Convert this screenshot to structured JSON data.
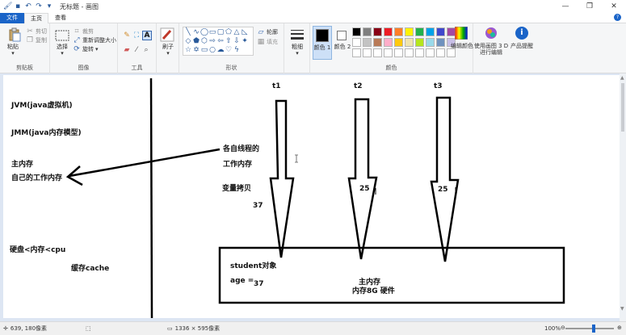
{
  "window": {
    "title": "无标题 - 画图",
    "controls": [
      "—",
      "❐",
      "✕"
    ]
  },
  "menu": {
    "file": "文件",
    "tabs": [
      "主页",
      "查看"
    ]
  },
  "ribbon": {
    "clipboard": {
      "paste": "粘贴",
      "cut": "剪切",
      "copy": "复制",
      "label": "剪贴板"
    },
    "image": {
      "select": "选择",
      "crop": "裁剪",
      "resize": "重新调整大小",
      "rotate": "旋转",
      "label": "图像"
    },
    "tools": {
      "label": "工具"
    },
    "brushes": {
      "label": "刷子"
    },
    "shapes": {
      "outline": "轮廓",
      "fill": "填充",
      "label": "形状"
    },
    "size": {
      "label": "粗细"
    },
    "color1": {
      "label": "颜色 1",
      "value": "#000000"
    },
    "color2": {
      "label": "颜色 2",
      "value": "#ffffff"
    },
    "palette": {
      "label": "颜色",
      "row1": [
        "#000000",
        "#7f7f7f",
        "#880015",
        "#ed1c24",
        "#ff7f27",
        "#fff200",
        "#22b14c",
        "#00a2e8",
        "#3f48cc",
        "#a349a4"
      ],
      "row2": [
        "#ffffff",
        "#c3c3c3",
        "#b97a57",
        "#ffaec9",
        "#ffc90e",
        "#efe4b0",
        "#b5e61d",
        "#99d9ea",
        "#7092be",
        "#c8bfe7"
      ],
      "row3": [
        "#ffffff",
        "#ffffff",
        "#ffffff",
        "#ffffff",
        "#ffffff",
        "#ffffff",
        "#ffffff",
        "#ffffff",
        "#ffffff",
        "#ffffff"
      ]
    },
    "edit_colors": "编辑颜色",
    "paint3d": "使用画图 3 D 进行编辑",
    "product_alert": "产品提醒"
  },
  "canvas_text": {
    "jvm": "JVM(java虚拟机)",
    "jmm": "JMM(java内存模型)",
    "main_mem": "主内存",
    "own_work_mem": "自己的工作内存",
    "each_thread": "各自线程的",
    "work_mem": "工作内存",
    "var_copy": "变量拷贝",
    "val_37": "37",
    "disk": "硬盘<内存<cpu",
    "cache": "缓存cache",
    "t1": "t1",
    "t2": "t2",
    "t3": "t3",
    "val_25a": "25",
    "val_25b": "25",
    "student": "student对象",
    "age": "age =",
    "age_val": "37",
    "box_main": "主内存",
    "box_hw": "内存8G 硬件"
  },
  "status": {
    "cursor": "639, 180像素",
    "canvas_size": "1336 × 595像素",
    "zoom": "100%"
  }
}
